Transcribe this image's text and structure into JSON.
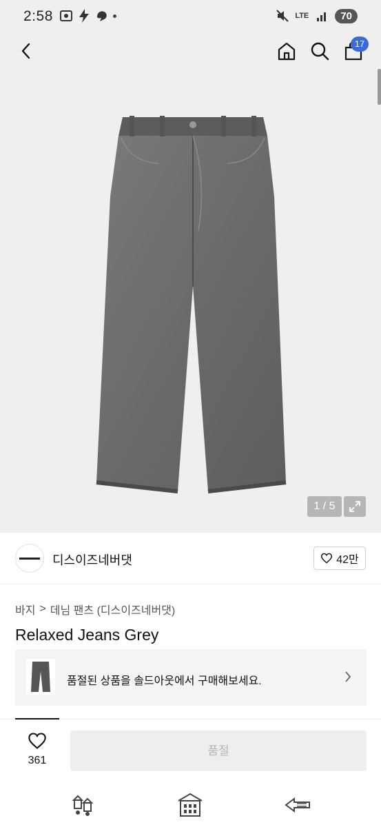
{
  "status_bar": {
    "time": "2:58",
    "network": "LTE",
    "battery": "70"
  },
  "header": {
    "cart_count": "17"
  },
  "gallery": {
    "counter": "1 / 5"
  },
  "brand": {
    "name": "디스이즈네버댓",
    "likes": "42만"
  },
  "breadcrumb": {
    "level1": "바지",
    "separator": ">",
    "level2": "데님 팬츠 (디스이즈네버댓)"
  },
  "product": {
    "title": "Relaxed Jeans Grey"
  },
  "soldout_banner": {
    "text": "품절된 상품을 솔드아웃에서 구매해보세요."
  },
  "purchase_bar": {
    "wish_count": "361",
    "button_label": "품절"
  },
  "colors": {
    "accent_badge": "#3a6bd8",
    "denim_grey": "#6e6e6c",
    "disabled_button_bg": "#eeeeee",
    "disabled_button_text": "#b5b5b5"
  },
  "icons": [
    "back-arrow-icon",
    "home-icon",
    "search-icon",
    "cart-icon",
    "expand-icon",
    "heart-icon",
    "chevron-right-icon"
  ]
}
